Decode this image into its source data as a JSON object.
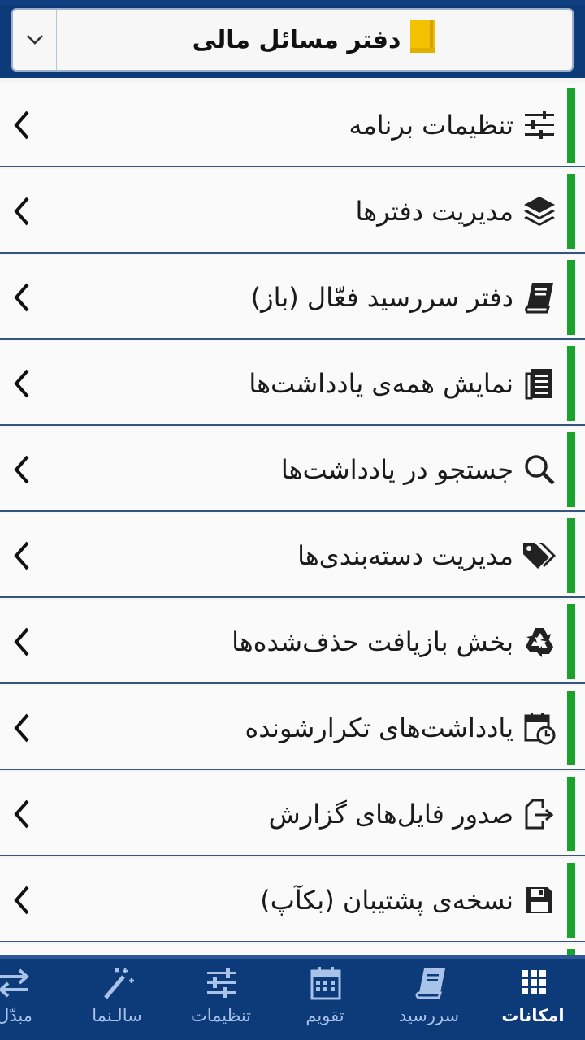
{
  "header": {
    "notebook_title": "دفتر مسائل مالی"
  },
  "menu": {
    "items": [
      {
        "label": "تنظیمات برنامه",
        "icon": "sliders-icon"
      },
      {
        "label": "مدیریت دفترها",
        "icon": "layers-icon"
      },
      {
        "label": "دفتر سررسید فعّال (باز)",
        "icon": "book-icon"
      },
      {
        "label": "نمایش همه‌ی یادداشت‌ها",
        "icon": "list-page-icon"
      },
      {
        "label": "جستجو در یادداشت‌ها",
        "icon": "search-icon"
      },
      {
        "label": "مدیریت دسته‌بندی‌ها",
        "icon": "tags-icon"
      },
      {
        "label": "بخش بازیافت حذف‌شده‌ها",
        "icon": "recycle-icon"
      },
      {
        "label": "یادداشت‌های تکرارشونده",
        "icon": "calendar-clock-icon"
      },
      {
        "label": "صدور فایل‌های گزارش",
        "icon": "export-icon"
      },
      {
        "label": "نسخه‌ی پشتیبان (بکآپ)",
        "icon": "save-icon"
      }
    ]
  },
  "nav": {
    "items": [
      {
        "label": "امکانات",
        "icon": "grid-icon",
        "active": true
      },
      {
        "label": "سررسید",
        "icon": "book-icon",
        "active": false
      },
      {
        "label": "تقویم",
        "icon": "calendar-icon",
        "active": false
      },
      {
        "label": "تنظیمات",
        "icon": "sliders-icon",
        "active": false
      },
      {
        "label": "سالـنما",
        "icon": "magic-wand-icon",
        "active": false
      },
      {
        "label": "مبدّل",
        "icon": "swap-icon",
        "active": false
      }
    ]
  },
  "colors": {
    "header_bg": "#0d3a78",
    "accent_bar": "#1aa32a",
    "notebook_icon": "#f2c200",
    "nav_inactive": "#a8c2e8",
    "nav_active": "#ffffff"
  }
}
